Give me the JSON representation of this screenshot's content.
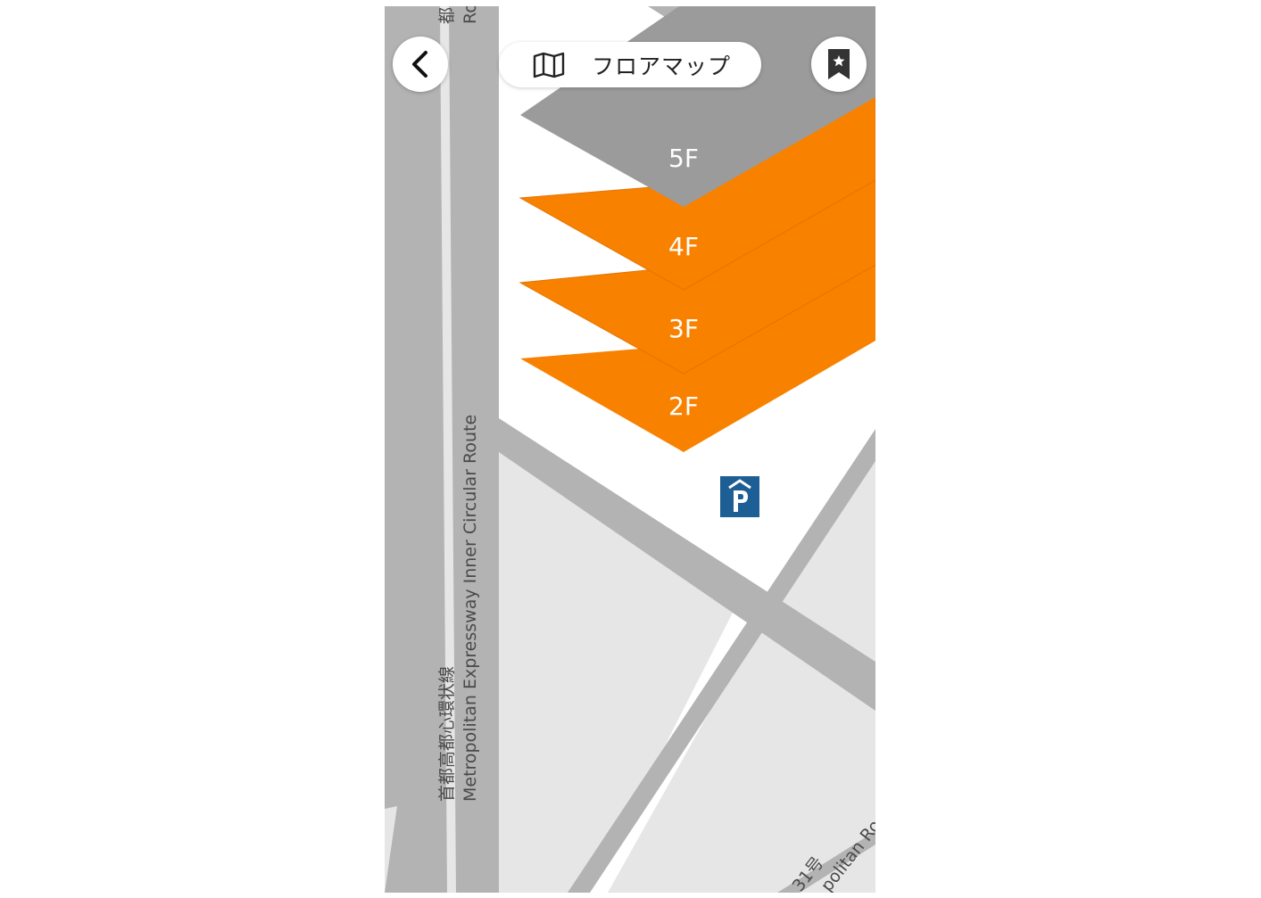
{
  "header": {
    "title": "フロアマップ",
    "back_icon": "chevron-left-icon",
    "map_icon": "folded-map-icon",
    "bookmark_icon": "bookmark-star-icon"
  },
  "map": {
    "road_labels": {
      "expressway_ja": "首都高都心環状線",
      "expressway_en": "Metropolitan Expressway Inner Circular Route",
      "top_partial_ja": "都",
      "top_partial_en": "Ro",
      "bottom_route_ja": "31号",
      "bottom_route_en": "politan Ro"
    },
    "floors": [
      {
        "label": "5F",
        "active": false
      },
      {
        "label": "4F",
        "active": true
      },
      {
        "label": "3F",
        "active": true
      },
      {
        "label": "2F",
        "active": true
      }
    ],
    "parking_icon": "parking-garage-icon",
    "colors": {
      "active_floor": "#F98100",
      "inactive_floor": "#9B9B9B",
      "road": "#B3B3B3",
      "block": "#E6E6E7",
      "parking": "#1D5F94"
    }
  }
}
